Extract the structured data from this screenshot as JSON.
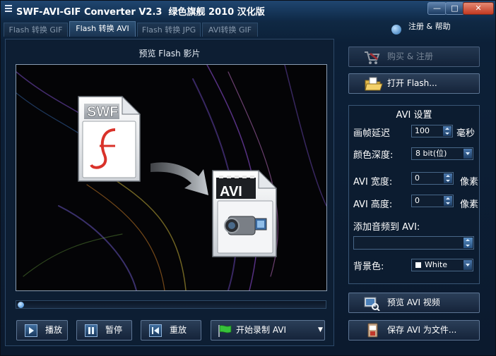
{
  "window": {
    "title": "SWF-AVI-GIF Converter V2.3",
    "title_suffix": "绿色旗舰 2010 汉化版",
    "controls": {
      "minimize": "—",
      "maximize": "□",
      "close": "✕"
    }
  },
  "tabs": [
    {
      "label": "Flash 转换 GIF",
      "active": false
    },
    {
      "label": "Flash 转换 AVI",
      "active": true
    },
    {
      "label": "Flash 转换 JPG",
      "active": false
    },
    {
      "label": "AVI转换 GIF",
      "active": false
    }
  ],
  "register": {
    "label": "注册 & 帮助"
  },
  "preview": {
    "label": "预览 Flash 影片",
    "swf_badge": "SWF",
    "avi_badge": "AVI",
    "progress": 0
  },
  "playback": {
    "play": "播放",
    "pause": "暂停",
    "replay": "重放",
    "record": "开始录制 AVI"
  },
  "actions": {
    "buy": "购买 & 注册",
    "open": "打开 Flash...",
    "preview_avi": "预览 AVI 视频",
    "save_avi": "保存 AVI 为文件..."
  },
  "settings": {
    "title": "AVI 设置",
    "frame_delay": {
      "label": "画帧延迟",
      "value": "100",
      "unit": "毫秒"
    },
    "color_depth": {
      "label": "颜色深度:",
      "value": "8 bit(位)"
    },
    "width": {
      "label": "AVI 宽度:",
      "value": "0",
      "unit": "像素"
    },
    "height": {
      "label": "AVI 高度:",
      "value": "0",
      "unit": "像素"
    },
    "audio": {
      "label": "添加音频到 AVI:",
      "value": ""
    },
    "bg_color": {
      "label": "背景色:",
      "value": "White",
      "swatch": "#ffffff"
    }
  },
  "colors": {
    "accent": "#2b7fd6",
    "record_flag": "#37c23a",
    "panel_bg": "#0d1e33"
  }
}
